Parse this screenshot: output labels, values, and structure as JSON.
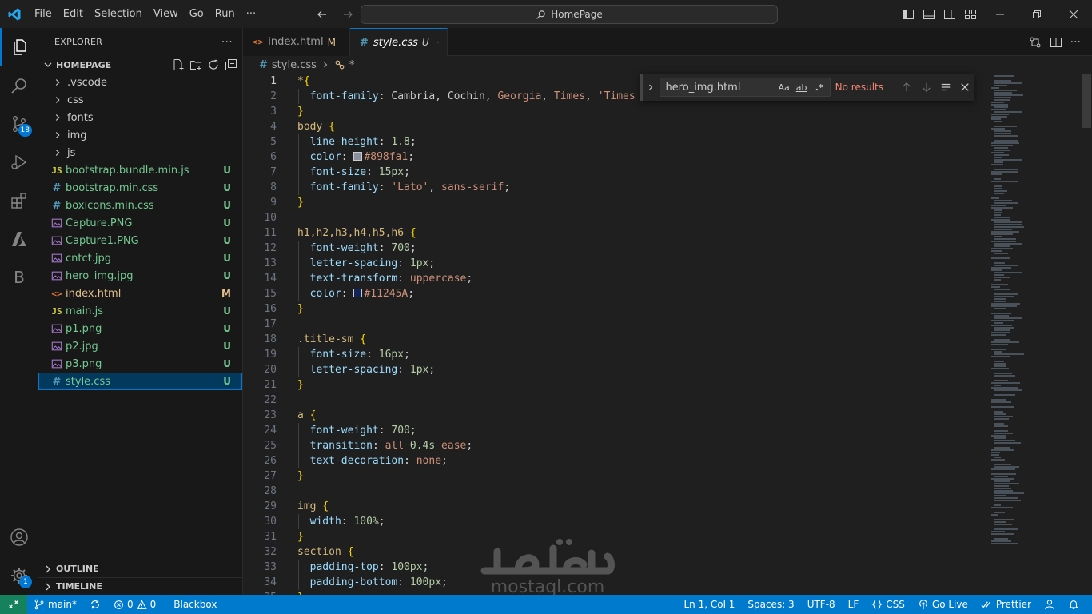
{
  "titlebar": {
    "menu": [
      "File",
      "Edit",
      "Selection",
      "View",
      "Go",
      "Run",
      "···"
    ],
    "search_text": "HomePage"
  },
  "activity_bar": {
    "source_control_badge": "18",
    "blackbox_letter": "B",
    "settings_badge": "1"
  },
  "explorer": {
    "title": "EXPLORER",
    "more": "···",
    "folder": "HOMEPAGE",
    "items": [
      {
        "name": ".vscode",
        "type": "folder",
        "status": ""
      },
      {
        "name": "css",
        "type": "folder",
        "status": ""
      },
      {
        "name": "fonts",
        "type": "folder",
        "status": ""
      },
      {
        "name": "img",
        "type": "folder",
        "status": ""
      },
      {
        "name": "js",
        "type": "folder",
        "status": ""
      },
      {
        "name": "bootstrap.bundle.min.js",
        "type": "js",
        "status": "U"
      },
      {
        "name": "bootstrap.min.css",
        "type": "css",
        "status": "U"
      },
      {
        "name": "boxicons.min.css",
        "type": "css",
        "status": "U"
      },
      {
        "name": "Capture.PNG",
        "type": "image",
        "status": "U"
      },
      {
        "name": "Capture1.PNG",
        "type": "image",
        "status": "U"
      },
      {
        "name": "cntct.jpg",
        "type": "image",
        "status": "U"
      },
      {
        "name": "hero_img.jpg",
        "type": "image",
        "status": "U"
      },
      {
        "name": "index.html",
        "type": "html",
        "status": "M"
      },
      {
        "name": "main.js",
        "type": "js",
        "status": "U"
      },
      {
        "name": "p1.png",
        "type": "image",
        "status": "U"
      },
      {
        "name": "p2.jpg",
        "type": "image",
        "status": "U"
      },
      {
        "name": "p3.png",
        "type": "image",
        "status": "U"
      },
      {
        "name": "style.css",
        "type": "css",
        "status": "U"
      }
    ],
    "outline": "OUTLINE",
    "timeline": "TIMELINE"
  },
  "tabs": [
    {
      "label": "index.html",
      "mod": "M",
      "active": false
    },
    {
      "label": "style.css",
      "mod": "U",
      "active": true
    }
  ],
  "breadcrumbs": {
    "file": "style.css",
    "symbol": "*"
  },
  "find": {
    "query": "hero_img.html",
    "opt_case": "Aa",
    "opt_word": "ab",
    "opt_regex": ".*",
    "result": "No results"
  },
  "code": [
    [
      [
        "*",
        "sel"
      ],
      [
        "{",
        "brace"
      ]
    ],
    [
      [
        "  "
      ],
      [
        "font-family",
        "prop"
      ],
      [
        ": ",
        "punc"
      ],
      [
        "Cambria",
        "punc"
      ],
      [
        ", ",
        "punc"
      ],
      [
        "Cochin",
        "punc"
      ],
      [
        ", ",
        "punc"
      ],
      [
        "Georgia",
        "val"
      ],
      [
        ", ",
        "punc"
      ],
      [
        "Times",
        "val"
      ],
      [
        ", ",
        "punc"
      ],
      [
        "'Times",
        "str"
      ]
    ],
    [
      [
        "}",
        "brace"
      ]
    ],
    [
      [
        "body ",
        "sel"
      ],
      [
        "{",
        "brace"
      ]
    ],
    [
      [
        "  "
      ],
      [
        "line-height",
        "prop"
      ],
      [
        ": ",
        "punc"
      ],
      [
        "1.8",
        "num"
      ],
      [
        ";",
        "punc"
      ]
    ],
    [
      [
        "  "
      ],
      [
        "color",
        "prop"
      ],
      [
        ": ",
        "punc"
      ],
      [
        "#swatch:#898fa1",
        "swatch"
      ],
      [
        "#898fa1",
        "val"
      ],
      [
        ";",
        "punc"
      ]
    ],
    [
      [
        "  "
      ],
      [
        "font-size",
        "prop"
      ],
      [
        ": ",
        "punc"
      ],
      [
        "15px",
        "num"
      ],
      [
        ";",
        "punc"
      ]
    ],
    [
      [
        "  "
      ],
      [
        "font-family",
        "prop"
      ],
      [
        ": ",
        "punc"
      ],
      [
        "'Lato'",
        "str"
      ],
      [
        ", ",
        "punc"
      ],
      [
        "sans-serif",
        "val"
      ],
      [
        ";",
        "punc"
      ]
    ],
    [
      [
        "}",
        "brace"
      ]
    ],
    [],
    [
      [
        "h1,h2,h3,h4,h5,h6 ",
        "sel"
      ],
      [
        "{",
        "brace"
      ]
    ],
    [
      [
        "  "
      ],
      [
        "font-weight",
        "prop"
      ],
      [
        ": ",
        "punc"
      ],
      [
        "700",
        "num"
      ],
      [
        ";",
        "punc"
      ]
    ],
    [
      [
        "  "
      ],
      [
        "letter-spacing",
        "prop"
      ],
      [
        ": ",
        "punc"
      ],
      [
        "1px",
        "num"
      ],
      [
        ";",
        "punc"
      ]
    ],
    [
      [
        "  "
      ],
      [
        "text-transform",
        "prop"
      ],
      [
        ": ",
        "punc"
      ],
      [
        "uppercase",
        "val"
      ],
      [
        ";",
        "punc"
      ]
    ],
    [
      [
        "  "
      ],
      [
        "color",
        "prop"
      ],
      [
        ": ",
        "punc"
      ],
      [
        "#swatch:#11245A",
        "swatch"
      ],
      [
        "#11245A",
        "val"
      ],
      [
        ";",
        "punc"
      ]
    ],
    [
      [
        "}",
        "brace"
      ]
    ],
    [],
    [
      [
        ".title-sm ",
        "sel"
      ],
      [
        "{",
        "brace"
      ]
    ],
    [
      [
        "  "
      ],
      [
        "font-size",
        "prop"
      ],
      [
        ": ",
        "punc"
      ],
      [
        "16px",
        "num"
      ],
      [
        ";",
        "punc"
      ]
    ],
    [
      [
        "  "
      ],
      [
        "letter-spacing",
        "prop"
      ],
      [
        ": ",
        "punc"
      ],
      [
        "1px",
        "num"
      ],
      [
        ";",
        "punc"
      ]
    ],
    [
      [
        "}",
        "brace"
      ]
    ],
    [],
    [
      [
        "a ",
        "sel"
      ],
      [
        "{",
        "brace"
      ]
    ],
    [
      [
        "  "
      ],
      [
        "font-weight",
        "prop"
      ],
      [
        ": ",
        "punc"
      ],
      [
        "700",
        "num"
      ],
      [
        ";",
        "punc"
      ]
    ],
    [
      [
        "  "
      ],
      [
        "transition",
        "prop"
      ],
      [
        ": ",
        "punc"
      ],
      [
        "all ",
        "val"
      ],
      [
        "0.4s",
        "num"
      ],
      [
        " ease",
        "val"
      ],
      [
        ";",
        "punc"
      ]
    ],
    [
      [
        "  "
      ],
      [
        "text-decoration",
        "prop"
      ],
      [
        ": ",
        "punc"
      ],
      [
        "none",
        "val"
      ],
      [
        ";",
        "punc"
      ]
    ],
    [
      [
        "}",
        "brace"
      ]
    ],
    [],
    [
      [
        "img ",
        "sel"
      ],
      [
        "{",
        "brace"
      ]
    ],
    [
      [
        "  "
      ],
      [
        "width",
        "prop"
      ],
      [
        ": ",
        "punc"
      ],
      [
        "100%",
        "num"
      ],
      [
        ";",
        "punc"
      ]
    ],
    [
      [
        "}",
        "brace"
      ]
    ],
    [
      [
        "section ",
        "sel"
      ],
      [
        "{",
        "brace"
      ]
    ],
    [
      [
        "  "
      ],
      [
        "padding-top",
        "prop"
      ],
      [
        ": ",
        "punc"
      ],
      [
        "100px",
        "num"
      ],
      [
        ";",
        "punc"
      ]
    ],
    [
      [
        "  "
      ],
      [
        "padding-bottom",
        "prop"
      ],
      [
        ": ",
        "punc"
      ],
      [
        "100px",
        "num"
      ],
      [
        ";",
        "punc"
      ]
    ],
    [
      [
        "}",
        "brace"
      ]
    ]
  ],
  "watermark": {
    "text": "mostaql.com"
  },
  "statusbar": {
    "branch": "main*",
    "errors": "0",
    "warnings": "0",
    "blackbox": "Blackbox",
    "position": "Ln 1, Col 1",
    "spaces": "Spaces: 3",
    "encoding": "UTF-8",
    "eol": "LF",
    "language": "CSS",
    "golive": "Go Live",
    "prettier": "Prettier"
  },
  "colors": {
    "accent": "#0078d4",
    "statusbar": "#007acc",
    "untracked": "#73c991",
    "modified": "#e2c08d"
  }
}
